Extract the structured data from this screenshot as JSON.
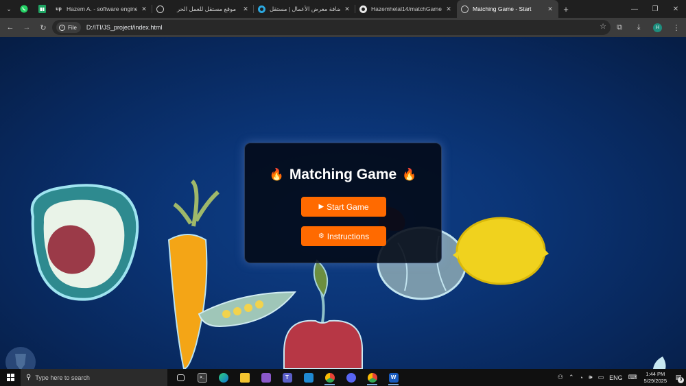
{
  "browser": {
    "tabs": [
      {
        "title": "Hazem A. - software engineering",
        "favicon": "upwork-icon",
        "active": false
      },
      {
        "title": "موقع مستقل للعمل الحر",
        "favicon": "mostaql-icon",
        "active": false
      },
      {
        "title": "إضافة معرض الأعمال | مستقل",
        "favicon": "mostaql-blue-icon",
        "active": false
      },
      {
        "title": "Hazemhelal14/matchGame",
        "favicon": "github-icon",
        "active": false
      },
      {
        "title": "Matching Game - Start",
        "favicon": "globe-icon",
        "active": true
      }
    ],
    "pinned_tabs": [
      "whatsapp-icon",
      "sheets-icon"
    ],
    "address": {
      "chip_label": "File",
      "url": "D:/ITI/JS_project/index.html"
    },
    "profile_initial": "H"
  },
  "page": {
    "title": "Matching Game",
    "title_emoji": "🔥",
    "start_button": {
      "icon": "▶",
      "label": "Start Game"
    },
    "instructions_button": {
      "icon": "⚙",
      "label": "Instructions"
    }
  },
  "taskbar": {
    "search_placeholder": "Type here to search",
    "apps": [
      "task-view-icon",
      "terminal-icon",
      "edge-icon",
      "file-explorer-icon",
      "visual-studio-icon",
      "teams-icon",
      "vscode-icon",
      "chrome-profile-icon",
      "discord-icon",
      "chrome-icon",
      "word-icon"
    ],
    "tray_language": "ENG",
    "time": "1:44 PM",
    "date": "5/29/2025",
    "notification_count": "3"
  },
  "colors": {
    "accent_button": "#ff6a00",
    "card_bg": "#030916",
    "page_bg": "#0b3577"
  }
}
